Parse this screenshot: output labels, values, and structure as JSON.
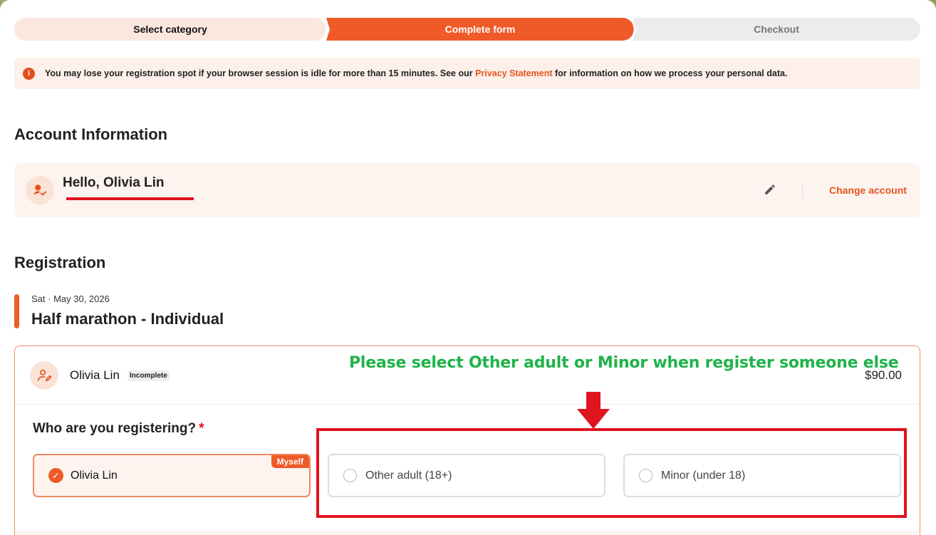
{
  "steps": [
    {
      "label": "Select category",
      "state": "done"
    },
    {
      "label": "Complete form",
      "state": "active"
    },
    {
      "label": "Checkout",
      "state": "upcoming"
    }
  ],
  "notice": {
    "icon": "info-icon",
    "text_before": "You may lose your registration spot if your browser session is idle for more than 15 minutes. See our ",
    "link": "Privacy Statement",
    "text_after": " for information on how we process your personal data."
  },
  "account": {
    "heading": "Account Information",
    "greeting": "Hello, Olivia Lin",
    "change_label": "Change account"
  },
  "registration": {
    "heading": "Registration",
    "event_date": "Sat · May 30, 2026",
    "event_title": "Half marathon - Individual",
    "participant_name": "Olivia Lin",
    "status_badge": "Incomplete",
    "price": "$90.00",
    "question": "Who are you registering?",
    "required_mark": "*",
    "options": [
      {
        "label": "Olivia Lin",
        "tag": "Myself",
        "selected": true
      },
      {
        "label": "Other adult (18+)",
        "selected": false
      },
      {
        "label": "Minor (under 18)",
        "selected": false
      }
    ]
  },
  "annotation": {
    "text": "Please select Other adult or Minor when register someone else",
    "color": "#1fb34a",
    "highlight_color": "#e0141e"
  },
  "colors": {
    "accent": "#f05a28",
    "accent_light": "#fbe7de"
  }
}
